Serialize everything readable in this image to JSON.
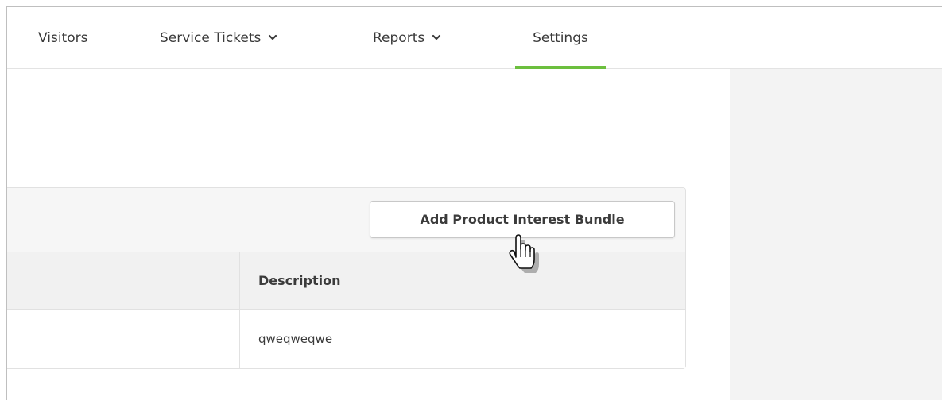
{
  "navigation": {
    "items": [
      {
        "label": "Visitors"
      },
      {
        "label": "Service Tickets"
      },
      {
        "label": "Reports"
      },
      {
        "label": "Settings"
      }
    ],
    "active": "Settings",
    "accent_color": "#6cbf3e"
  },
  "toolbar": {
    "add_button_label": "Add Product Interest Bundle"
  },
  "table": {
    "columns": [
      "",
      "Description"
    ],
    "rows": [
      {
        "name": "",
        "description": "qweqweqwe"
      }
    ]
  },
  "icons": {
    "nav_dropdown": "chevron-down-icon",
    "cursor": "hand-pointer-icon"
  }
}
